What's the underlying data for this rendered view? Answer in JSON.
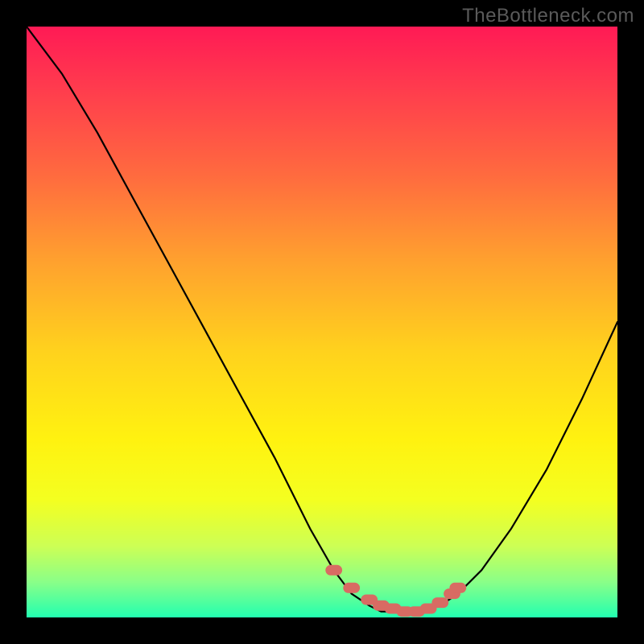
{
  "watermark": "TheBottleneck.com",
  "colors": {
    "background": "#000000",
    "gradient_stops": [
      {
        "offset": 0.0,
        "color": "#ff1a55"
      },
      {
        "offset": 0.1,
        "color": "#ff3a4e"
      },
      {
        "offset": 0.25,
        "color": "#ff6a3f"
      },
      {
        "offset": 0.4,
        "color": "#ffa22e"
      },
      {
        "offset": 0.55,
        "color": "#ffd21d"
      },
      {
        "offset": 0.7,
        "color": "#fff210"
      },
      {
        "offset": 0.8,
        "color": "#f4ff20"
      },
      {
        "offset": 0.88,
        "color": "#ccff55"
      },
      {
        "offset": 0.94,
        "color": "#8aff88"
      },
      {
        "offset": 1.0,
        "color": "#22ffb0"
      }
    ],
    "curve": "#000000",
    "marker_fill": "#d86b63",
    "marker_stroke": "#b24f49"
  },
  "chart_data": {
    "type": "line",
    "title": "",
    "xlabel": "",
    "ylabel": "",
    "ylim": [
      0,
      100
    ],
    "xlim": [
      0,
      100
    ],
    "series": [
      {
        "name": "bottleneck-curve",
        "x": [
          0,
          6,
          12,
          18,
          24,
          30,
          36,
          42,
          48,
          52,
          55,
          58,
          60,
          63,
          67,
          70,
          73,
          77,
          82,
          88,
          94,
          100
        ],
        "values": [
          100,
          92,
          82,
          71,
          60,
          49,
          38,
          27,
          15,
          8,
          4,
          2,
          1,
          1,
          1,
          2,
          4,
          8,
          15,
          25,
          37,
          50
        ]
      }
    ],
    "markers": {
      "name": "highlighted-range",
      "x": [
        52,
        55,
        58,
        60,
        62,
        64,
        66,
        68,
        70,
        72,
        73
      ],
      "values": [
        8,
        5,
        3,
        2,
        1.5,
        1,
        1,
        1.5,
        2.5,
        4,
        5
      ]
    }
  }
}
